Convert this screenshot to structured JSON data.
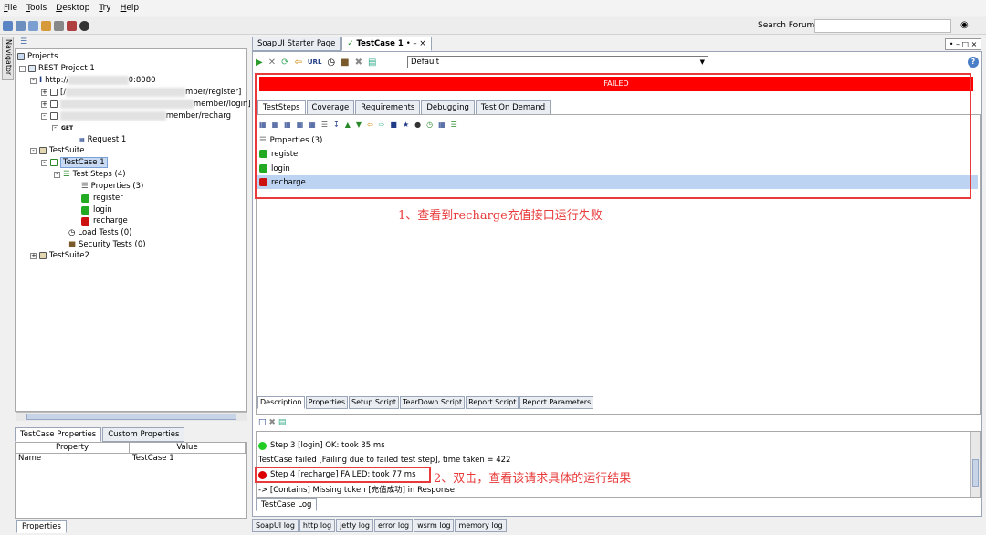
{
  "menu": [
    "File",
    "Tools",
    "Desktop",
    "Try",
    "Help"
  ],
  "search": {
    "label": "Search Forum",
    "value": ""
  },
  "navigator": {
    "label": "Navigator"
  },
  "tree": {
    "projects": "Projects",
    "project": "REST Project 1",
    "service": "http://",
    "service_port": "0:8080",
    "res1": "mber/register]",
    "res2": "member/login]",
    "res3": "member/recharg",
    "method": "GET",
    "request": "Request 1",
    "suite": "TestSuite",
    "testcase": "TestCase 1",
    "teststeps": "Test Steps (4)",
    "properties": "Properties (3)",
    "register": "register",
    "login": "login",
    "recharge": "recharge",
    "loadtests": "Load Tests (0)",
    "securitytests": "Security Tests (0)",
    "suite2": "TestSuite2"
  },
  "left_props": {
    "tabs": [
      "TestCase Properties",
      "Custom Properties"
    ],
    "headers": [
      "Property",
      "Value"
    ],
    "rows": [
      {
        "name": "Name",
        "value": "TestCase 1"
      }
    ],
    "bottom_tab": "Properties"
  },
  "editor_tabs": [
    "SoapUI Starter Page",
    "TestCase 1"
  ],
  "editor": {
    "env_select": "Default",
    "status": "FAILED",
    "tabs": [
      "TestSteps",
      "Coverage",
      "Requirements",
      "Debugging",
      "Test On Demand"
    ],
    "steps": [
      {
        "label": "Properties (3)"
      },
      {
        "label": "register"
      },
      {
        "label": "login"
      },
      {
        "label": "recharge"
      }
    ],
    "annotation1": "1、查看到recharge充值接口运行失败",
    "desc_tabs": [
      "Description",
      "Properties",
      "Setup Script",
      "TearDown Script",
      "Report Script",
      "Report Parameters"
    ]
  },
  "log": {
    "lines": [
      "Step 3 [login] OK: took 35 ms",
      "TestCase failed [Failing due to failed test step], time taken = 422",
      "Step 4 [recharge] FAILED: took 77 ms",
      "-> [Contains] Missing token [充值成功] in Response"
    ],
    "annotation2": "2、双击，查看该请求具体的运行结果",
    "tab": "TestCase Log"
  },
  "bottom_tabs": [
    "SoapUI log",
    "http log",
    "jetty log",
    "error log",
    "wsrm log",
    "memory log"
  ],
  "colors": {
    "failed": "#ff0000",
    "ok": "#22aa22",
    "annotation": "#e83a3a",
    "selected": "#bcd3f2"
  }
}
